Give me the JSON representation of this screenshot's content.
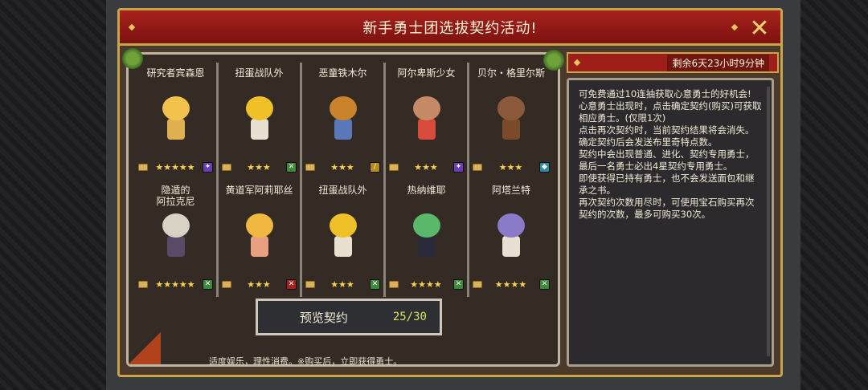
{
  "dialog": {
    "title": "新手勇士团选拔契约活动!",
    "close_icon": "close-icon",
    "timer": "剩余6天23小时9分钟"
  },
  "heroes": [
    {
      "name": "研究者宾森恩",
      "stars": "★★★★★",
      "type_icon": "magic-staff-icon",
      "type_color": "#6a3fb3",
      "hair": "#f3c24a",
      "body": "#e0b050"
    },
    {
      "name": "扭蛋战队外",
      "stars": "★★★",
      "type_icon": "crossed-swords-icon",
      "type_color": "#3d8a3a",
      "hair": "#f0c028",
      "body": "#e8e0d0"
    },
    {
      "name": "恶童铁木尔",
      "stars": "★★★",
      "type_icon": "sword-icon",
      "type_color": "#b88a18",
      "hair": "#c9832a",
      "body": "#5a78b8"
    },
    {
      "name": "阿尔卑斯少女",
      "stars": "★★★",
      "type_icon": "magic-staff-icon",
      "type_color": "#6a3fb3",
      "hair": "#c78a66",
      "body": "#d84a3a"
    },
    {
      "name": "贝尔・格里尔斯",
      "stars": "★★★",
      "type_icon": "crystal-icon",
      "type_color": "#2f8aa8",
      "hair": "#8a5a3a",
      "body": "#7a4a2a"
    },
    {
      "name": "隐遁的\n阿拉克尼",
      "stars": "★★★★★",
      "type_icon": "crossed-swords-icon",
      "type_color": "#3d8a3a",
      "hair": "#d8d2c4",
      "body": "#5a4a6a"
    },
    {
      "name": "黄道军阿莉耶丝",
      "stars": "★★★",
      "type_icon": "no-sword-icon",
      "type_color": "#a82020",
      "hair": "#f0b840",
      "body": "#e8a080"
    },
    {
      "name": "扭蛋战队外",
      "stars": "★★★",
      "type_icon": "crossed-swords-icon",
      "type_color": "#3d8a3a",
      "hair": "#f0c028",
      "body": "#e8e0d0"
    },
    {
      "name": "热纳维耶",
      "stars": "★★★★",
      "type_icon": "crossed-swords-icon",
      "type_color": "#3d8a3a",
      "hair": "#5ab86a",
      "body": "#2a2a3a"
    },
    {
      "name": "阿塔兰特",
      "stars": "★★★★",
      "type_icon": "crossed-swords-icon",
      "type_color": "#3d8a3a",
      "hair": "#8a7ac8",
      "body": "#e8e0d0"
    }
  ],
  "preview": {
    "label": "预览契约",
    "count": "25/30"
  },
  "footer_note": "适度娱乐，理性消费。※购买后，立即获得勇士。",
  "description": [
    "可免费通过10连抽获取心意勇士的好机会!",
    "心意勇士出现时，点击确定契约(购买)可获取相应勇士。(仅限1次)",
    "点击再次契约时，当前契约结果将会消失。",
    "确定契约后会发送布里奇特点数。",
    "契约中会出现普通、进化、契约专用勇士，最后一名勇士必出4星契约专用勇士。",
    "即使获得已持有勇士，也不会发送面包和继承之书。",
    "再次契约次数用尽时，可使用宝石购买再次契约的次数，最多可购买30次。"
  ]
}
